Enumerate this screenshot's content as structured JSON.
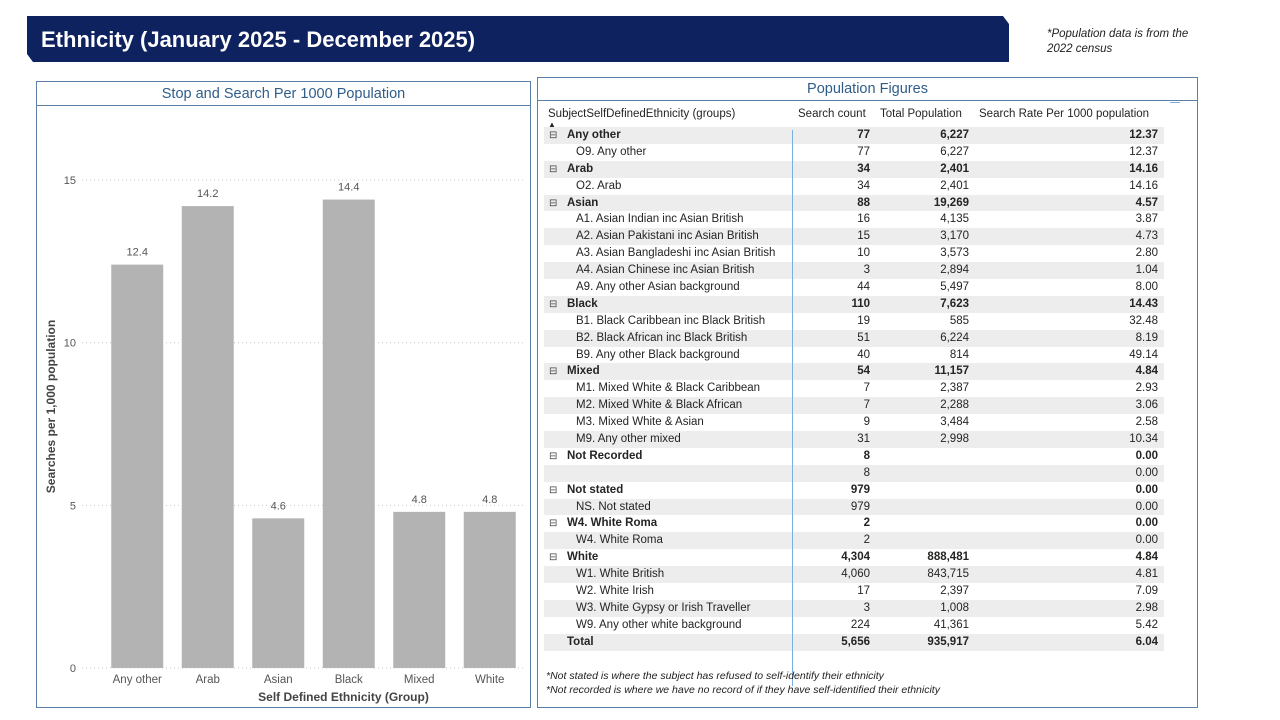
{
  "header": {
    "title": "Ethnicity (January 2025 - December 2025)",
    "note": "*Population data is from the 2022 census",
    "banner_color": "#0e2260"
  },
  "chart_panel": {
    "title": "Stop and Search Per 1000 Population"
  },
  "chart_data": {
    "type": "bar",
    "title": "Stop and Search Per 1000 Population",
    "categories": [
      "Any other",
      "Arab",
      "Asian",
      "Black",
      "Mixed",
      "White"
    ],
    "values": [
      12.4,
      14.2,
      4.6,
      14.4,
      4.8,
      4.8
    ],
    "data_labels": [
      "12.4",
      "14.2",
      "4.6",
      "14.4",
      "4.8",
      "4.8"
    ],
    "xlabel": "Self Defined Ethnicity (Group)",
    "ylabel": "Searches per 1,000 population",
    "ylim": [
      0,
      17
    ],
    "yticks": [
      0,
      5,
      10,
      15
    ],
    "grid": true,
    "bar_color": "#b3b3b3"
  },
  "table_panel": {
    "title": "Population Figures",
    "columns": [
      "SubjectSelfDefinedEthnicity (groups)",
      "Search count",
      "Total Population",
      "Search Rate Per 1000 population"
    ],
    "rows": [
      {
        "type": "group",
        "label": "Any other",
        "count": "77",
        "pop": "6,227",
        "rate": "12.37"
      },
      {
        "type": "child",
        "label": "O9. Any other",
        "count": "77",
        "pop": "6,227",
        "rate": "12.37"
      },
      {
        "type": "group",
        "label": "Arab",
        "count": "34",
        "pop": "2,401",
        "rate": "14.16"
      },
      {
        "type": "child",
        "label": "O2. Arab",
        "count": "34",
        "pop": "2,401",
        "rate": "14.16"
      },
      {
        "type": "group",
        "label": "Asian",
        "count": "88",
        "pop": "19,269",
        "rate": "4.57"
      },
      {
        "type": "child",
        "label": "A1. Asian Indian inc Asian British",
        "count": "16",
        "pop": "4,135",
        "rate": "3.87"
      },
      {
        "type": "child",
        "label": "A2. Asian Pakistani inc Asian British",
        "count": "15",
        "pop": "3,170",
        "rate": "4.73"
      },
      {
        "type": "child",
        "label": "A3. Asian Bangladeshi inc Asian British",
        "count": "10",
        "pop": "3,573",
        "rate": "2.80"
      },
      {
        "type": "child",
        "label": "A4. Asian Chinese inc Asian British",
        "count": "3",
        "pop": "2,894",
        "rate": "1.04"
      },
      {
        "type": "child",
        "label": "A9. Any other Asian background",
        "count": "44",
        "pop": "5,497",
        "rate": "8.00"
      },
      {
        "type": "group",
        "label": "Black",
        "count": "110",
        "pop": "7,623",
        "rate": "14.43"
      },
      {
        "type": "child",
        "label": "B1. Black Caribbean inc Black British",
        "count": "19",
        "pop": "585",
        "rate": "32.48"
      },
      {
        "type": "child",
        "label": "B2. Black African inc Black British",
        "count": "51",
        "pop": "6,224",
        "rate": "8.19"
      },
      {
        "type": "child",
        "label": "B9. Any other Black background",
        "count": "40",
        "pop": "814",
        "rate": "49.14"
      },
      {
        "type": "group",
        "label": "Mixed",
        "count": "54",
        "pop": "11,157",
        "rate": "4.84"
      },
      {
        "type": "child",
        "label": "M1. Mixed White & Black Caribbean",
        "count": "7",
        "pop": "2,387",
        "rate": "2.93"
      },
      {
        "type": "child",
        "label": "M2. Mixed White & Black African",
        "count": "7",
        "pop": "2,288",
        "rate": "3.06"
      },
      {
        "type": "child",
        "label": "M3. Mixed White & Asian",
        "count": "9",
        "pop": "3,484",
        "rate": "2.58"
      },
      {
        "type": "child",
        "label": "M9. Any other mixed",
        "count": "31",
        "pop": "2,998",
        "rate": "10.34"
      },
      {
        "type": "group",
        "label": "Not Recorded",
        "count": "8",
        "pop": "",
        "rate": "0.00"
      },
      {
        "type": "child",
        "label": "",
        "count": "8",
        "pop": "",
        "rate": "0.00"
      },
      {
        "type": "group",
        "label": "Not stated",
        "count": "979",
        "pop": "",
        "rate": "0.00"
      },
      {
        "type": "child",
        "label": "NS. Not stated",
        "count": "979",
        "pop": "",
        "rate": "0.00"
      },
      {
        "type": "group",
        "label": "W4. White Roma",
        "count": "2",
        "pop": "",
        "rate": "0.00"
      },
      {
        "type": "child",
        "label": "W4. White Roma",
        "count": "2",
        "pop": "",
        "rate": "0.00"
      },
      {
        "type": "group",
        "label": "White",
        "count": "4,304",
        "pop": "888,481",
        "rate": "4.84"
      },
      {
        "type": "child",
        "label": "W1. White British",
        "count": "4,060",
        "pop": "843,715",
        "rate": "4.81"
      },
      {
        "type": "child",
        "label": "W2. White Irish",
        "count": "17",
        "pop": "2,397",
        "rate": "7.09"
      },
      {
        "type": "child",
        "label": "W3. White Gypsy or Irish Traveller",
        "count": "3",
        "pop": "1,008",
        "rate": "2.98"
      },
      {
        "type": "child",
        "label": "W9. Any other white background",
        "count": "224",
        "pop": "41,361",
        "rate": "5.42"
      },
      {
        "type": "total",
        "label": "Total",
        "count": "5,656",
        "pop": "935,917",
        "rate": "6.04"
      }
    ],
    "footnotes": [
      "*Not stated is where the subject has refused to self-identify their ethnicity",
      "*Not recorded is where we have no record of if they have self-identified their ethnicity"
    ]
  }
}
